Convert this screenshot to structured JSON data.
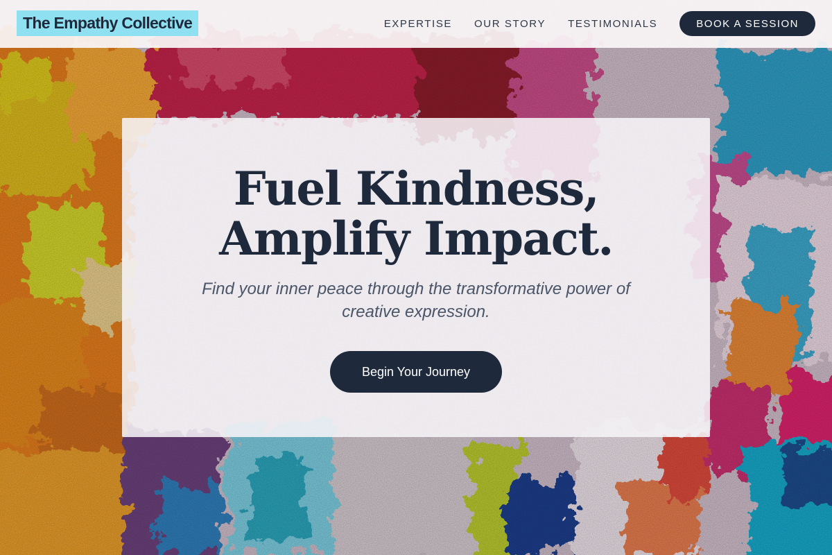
{
  "header": {
    "logo": "The Empathy Collective",
    "nav": {
      "expertise": "EXPERTISE",
      "our_story": "OUR STORY",
      "testimonials": "TESTIMONIALS"
    },
    "book_button": "BOOK A SESSION"
  },
  "hero": {
    "title_line1": "Fuel Kindness,",
    "title_line2": "Amplify Impact.",
    "subtitle": "Find your inner peace through the transformative power of creative expression.",
    "cta": "Begin Your Journey",
    "background_image": "abstract colorful oil paint impasto texture"
  },
  "colors": {
    "primary_dark": "#1e293b",
    "logo_highlight": "#8fe1f2",
    "body_text": "#4a5568"
  }
}
